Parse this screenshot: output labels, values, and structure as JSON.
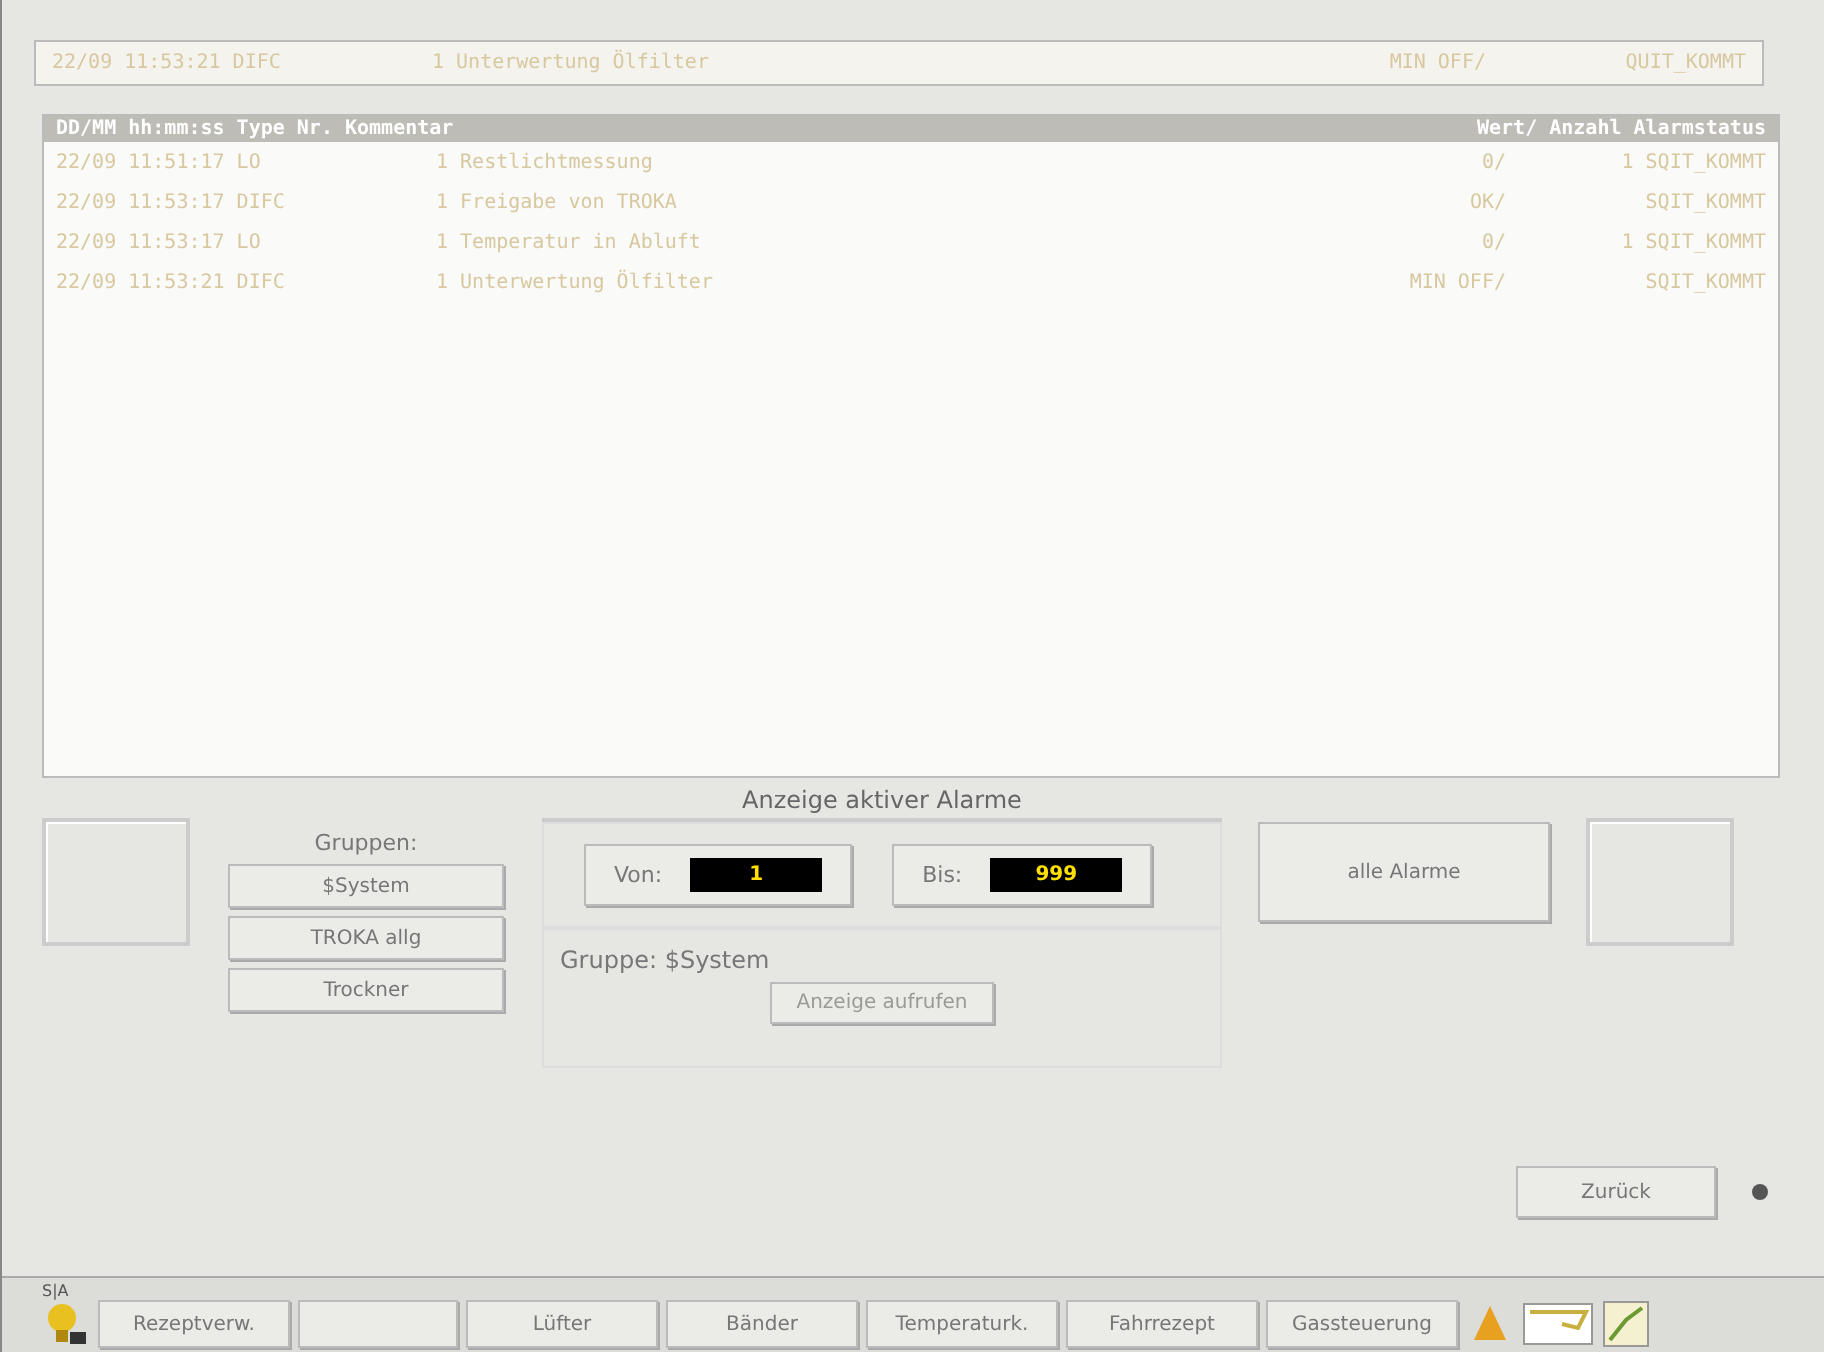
{
  "current_alarm": {
    "time": "22/09 11:53:21 DIFC",
    "text": "1 Unterwertung Ölfilter",
    "value": "MIN OFF/",
    "status": "QUIT_KOMMT"
  },
  "alarm_table": {
    "columns": [
      "DD/MM hh:mm:ss Type Nr. Kommentar",
      "Wert/ Anzahl Alarmstatus"
    ],
    "rows": [
      {
        "time": "22/09 11:51:17 LO",
        "text": "1 Restlichtmessung",
        "value": "0/",
        "status": "1 SQIT_KOMMT"
      },
      {
        "time": "22/09 11:53:17 DIFC",
        "text": "1 Freigabe von TROKA",
        "value": "OK/",
        "status": "SQIT_KOMMT"
      },
      {
        "time": "22/09 11:53:17 LO",
        "text": "1 Temperatur in Abluft",
        "value": "0/",
        "status": "1 SQIT_KOMMT"
      },
      {
        "time": "22/09 11:53:21 DIFC",
        "text": "1 Unterwertung Ölfilter",
        "value": "MIN OFF/",
        "status": "SQIT_KOMMT"
      }
    ]
  },
  "groups": {
    "label": "Gruppen:",
    "buttons": [
      "$System",
      "TROKA allg",
      "Trockner"
    ]
  },
  "display": {
    "title": "Anzeige aktiver Alarme",
    "from_label": "Von:",
    "from_value": "1",
    "to_label": "Bis:",
    "to_value": "999",
    "group_text": "Gruppe: $System",
    "open_button": {
      "label": "Anzeige aufrufen",
      "disabled": true
    }
  },
  "all_alarms_button": "alle Alarme",
  "back_button": "Zurück",
  "status_label": "S|A",
  "nav_buttons": [
    {
      "kind": "text",
      "label": "Rezeptverw."
    },
    {
      "kind": "blank"
    },
    {
      "kind": "text",
      "label": "Lüfter"
    },
    {
      "kind": "text",
      "label": "Bänder"
    },
    {
      "kind": "text",
      "label": "Temperaturk."
    },
    {
      "kind": "text",
      "label": "Fahrrezept"
    },
    {
      "kind": "text",
      "label": "Gassteuerung"
    }
  ]
}
